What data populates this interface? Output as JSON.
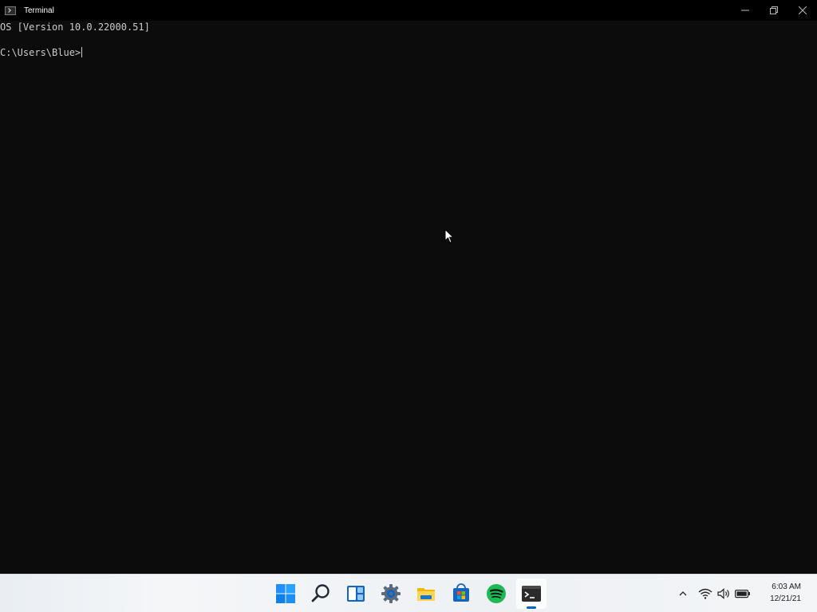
{
  "window": {
    "title": "Terminal",
    "icon": "terminal-icon",
    "controls": [
      "minimize-icon",
      "restore-icon",
      "close-icon"
    ]
  },
  "terminal": {
    "lines": [
      "OS [Version 10.0.22000.51]",
      "C:\\Users\\Blue>"
    ],
    "background": "#0c0c0c",
    "foreground": "#cccccc"
  },
  "taskbar": {
    "items": [
      {
        "name": "start-button",
        "icon": "windows-logo-icon"
      },
      {
        "name": "search-button",
        "icon": "search-icon"
      },
      {
        "name": "widgets-button",
        "icon": "widgets-icon"
      },
      {
        "name": "settings-app",
        "icon": "gear-icon"
      },
      {
        "name": "file-explorer-app",
        "icon": "folder-icon"
      },
      {
        "name": "microsoft-store-app",
        "icon": "store-icon"
      },
      {
        "name": "spotify-app",
        "icon": "spotify-icon"
      },
      {
        "name": "terminal-app",
        "icon": "terminal-icon",
        "active": true
      }
    ],
    "tray": [
      "chevron-up-icon",
      "wifi-icon",
      "volume-icon",
      "battery-icon"
    ],
    "clock": {
      "time": "6:03 AM",
      "date": "12/21/21"
    },
    "accent": "#0067c0"
  }
}
